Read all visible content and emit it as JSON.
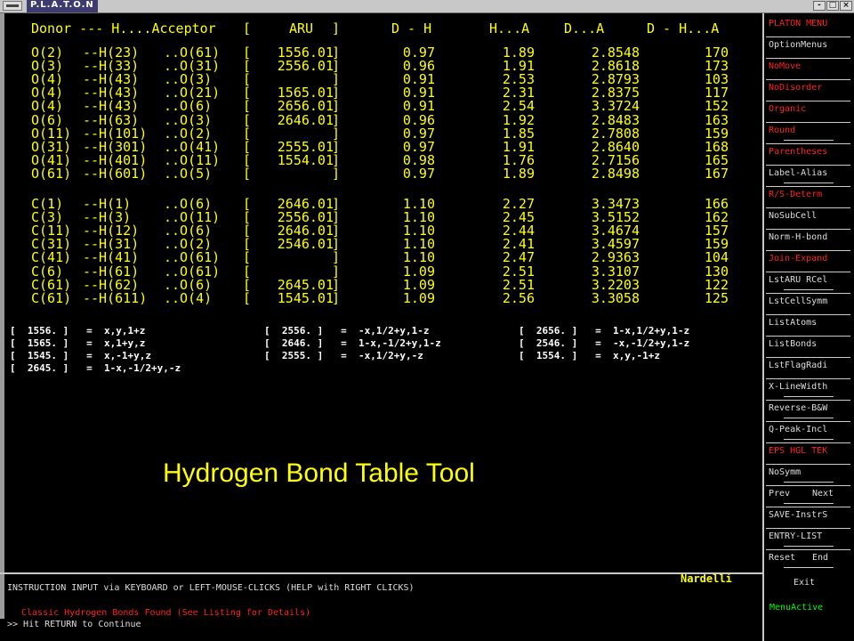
{
  "window": {
    "title": "P.L.A.T.O.N",
    "buttons": [
      "-",
      "□",
      "×"
    ]
  },
  "table": {
    "headers": [
      "Donor --- H....Acceptor",
      "[",
      "ARU",
      "]",
      "D - H",
      "H...A",
      "D...A",
      "D - H...A"
    ],
    "group1": [
      {
        "d": "O(2)",
        "h": "--H(23)",
        "a": "..O(61)",
        "aru": "1556.01",
        "dh": "0.97",
        "ha": "1.89",
        "da": "2.8548",
        "ang": "170"
      },
      {
        "d": "O(3)",
        "h": "--H(33)",
        "a": "..O(31)",
        "aru": "2556.01",
        "dh": "0.96",
        "ha": "1.91",
        "da": "2.8618",
        "ang": "173"
      },
      {
        "d": "O(4)",
        "h": "--H(43)",
        "a": "..O(3)",
        "aru": "",
        "dh": "0.91",
        "ha": "2.53",
        "da": "2.8793",
        "ang": "103"
      },
      {
        "d": "O(4)",
        "h": "--H(43)",
        "a": "..O(21)",
        "aru": "1565.01",
        "dh": "0.91",
        "ha": "2.31",
        "da": "2.8375",
        "ang": "117"
      },
      {
        "d": "O(4)",
        "h": "--H(43)",
        "a": "..O(6)",
        "aru": "2656.01",
        "dh": "0.91",
        "ha": "2.54",
        "da": "3.3724",
        "ang": "152"
      },
      {
        "d": "O(6)",
        "h": "--H(63)",
        "a": "..O(3)",
        "aru": "2646.01",
        "dh": "0.96",
        "ha": "1.92",
        "da": "2.8483",
        "ang": "163"
      },
      {
        "d": "O(11)",
        "h": "--H(101)",
        "a": "..O(2)",
        "aru": "",
        "dh": "0.97",
        "ha": "1.85",
        "da": "2.7808",
        "ang": "159"
      },
      {
        "d": "O(31)",
        "h": "--H(301)",
        "a": "..O(41)",
        "aru": "2555.01",
        "dh": "0.97",
        "ha": "1.91",
        "da": "2.8640",
        "ang": "168"
      },
      {
        "d": "O(41)",
        "h": "--H(401)",
        "a": "..O(11)",
        "aru": "1554.01",
        "dh": "0.98",
        "ha": "1.76",
        "da": "2.7156",
        "ang": "165"
      },
      {
        "d": "O(61)",
        "h": "--H(601)",
        "a": "..O(5)",
        "aru": "",
        "dh": "0.97",
        "ha": "1.89",
        "da": "2.8498",
        "ang": "167"
      }
    ],
    "group2": [
      {
        "d": "C(1)",
        "h": "--H(1)",
        "a": "..O(6)",
        "aru": "2646.01",
        "dh": "1.10",
        "ha": "2.27",
        "da": "3.3473",
        "ang": "166"
      },
      {
        "d": "C(3)",
        "h": "--H(3)",
        "a": "..O(11)",
        "aru": "2556.01",
        "dh": "1.10",
        "ha": "2.45",
        "da": "3.5152",
        "ang": "162"
      },
      {
        "d": "C(11)",
        "h": "--H(12)",
        "a": "..O(6)",
        "aru": "2646.01",
        "dh": "1.10",
        "ha": "2.44",
        "da": "3.4674",
        "ang": "157"
      },
      {
        "d": "C(31)",
        "h": "--H(31)",
        "a": "..O(2)",
        "aru": "2546.01",
        "dh": "1.10",
        "ha": "2.41",
        "da": "3.4597",
        "ang": "159"
      },
      {
        "d": "C(41)",
        "h": "--H(41)",
        "a": "..O(61)",
        "aru": "",
        "dh": "1.10",
        "ha": "2.47",
        "da": "2.9363",
        "ang": "104"
      },
      {
        "d": "C(6)",
        "h": "--H(61)",
        "a": "..O(61)",
        "aru": "",
        "dh": "1.09",
        "ha": "2.51",
        "da": "3.3107",
        "ang": "130"
      },
      {
        "d": "C(61)",
        "h": "--H(62)",
        "a": "..O(6)",
        "aru": "2645.01",
        "dh": "1.09",
        "ha": "2.51",
        "da": "3.2203",
        "ang": "122"
      },
      {
        "d": "C(61)",
        "h": "--H(611)",
        "a": "..O(4)",
        "aru": "1545.01",
        "dh": "1.09",
        "ha": "2.56",
        "da": "3.3058",
        "ang": "125"
      }
    ]
  },
  "symmetry": [
    {
      "code": "1556.",
      "op": "x,y,1+z"
    },
    {
      "code": "2556.",
      "op": "-x,1/2+y,1-z"
    },
    {
      "code": "2656.",
      "op": "1-x,1/2+y,1-z"
    },
    {
      "code": "1565.",
      "op": "x,1+y,z"
    },
    {
      "code": "2646.",
      "op": "1-x,-1/2+y,1-z"
    },
    {
      "code": "2546.",
      "op": "-x,-1/2+y,1-z"
    },
    {
      "code": "1545.",
      "op": "x,-1+y,z"
    },
    {
      "code": "2555.",
      "op": "-x,1/2+y,-z"
    },
    {
      "code": "1554.",
      "op": "x,y,-1+z"
    },
    {
      "code": "2645.",
      "op": "1-x,-1/2+y,-z"
    }
  ],
  "caption": "Hydrogen Bond Table Tool",
  "author": "Nardelli",
  "menu": {
    "items": [
      {
        "label": "PLATON MENU",
        "style": "header"
      },
      {
        "label": "OptionMenus",
        "style": "normal"
      },
      {
        "label": "NoMove",
        "style": "red"
      },
      {
        "label": "NoDisorder",
        "style": "red"
      },
      {
        "label": "Organic",
        "style": "red"
      },
      {
        "label": "Round",
        "style": "red"
      },
      {
        "label": "Parentheses",
        "style": "red"
      },
      {
        "label": "Label-Alias",
        "style": "normal"
      },
      {
        "label": "R/S-Determ",
        "style": "red"
      },
      {
        "label": "NoSubCell",
        "style": "normal"
      },
      {
        "label": "Norm-H-bond",
        "style": "normal"
      },
      {
        "label": "Join-Expand",
        "style": "red"
      },
      {
        "label": "LstARU RCel",
        "style": "normal"
      },
      {
        "label": "LstCellSymm",
        "style": "normal"
      },
      {
        "label": "ListAtoms",
        "style": "normal"
      },
      {
        "label": "ListBonds",
        "style": "normal"
      },
      {
        "label": "LstFlagRadi",
        "style": "normal"
      },
      {
        "label": "X-LineWidth",
        "style": "normal"
      },
      {
        "label": "Reverse-B&W",
        "style": "normal"
      },
      {
        "label": "Q-Peak-Incl",
        "style": "normal"
      },
      {
        "label": "EPS HGL TEK",
        "style": "red"
      },
      {
        "label": "NoSymm",
        "style": "normal"
      },
      {
        "label": "Prev",
        "label2": "Next",
        "style": "normal"
      },
      {
        "label": "SAVE-InstrS",
        "style": "normal"
      },
      {
        "label": "ENTRY-LIST",
        "style": "normal"
      },
      {
        "label": "Reset",
        "label2": "End",
        "style": "normal"
      }
    ],
    "exit": "Exit",
    "status": "MenuActive"
  },
  "instruction": {
    "line1": "INSTRUCTION INPUT via KEYBOARD or LEFT-MOUSE-CLICKS (HELP with RIGHT CLICKS)",
    "line2": "Classic Hydrogen Bonds Found (See Listing for Details)",
    "line3": ">> Hit RETURN to Continue"
  },
  "colors": {
    "yellow": "#ffff00",
    "red": "#ff2222",
    "green": "#00ff00",
    "frame": "#c8c8c8"
  }
}
